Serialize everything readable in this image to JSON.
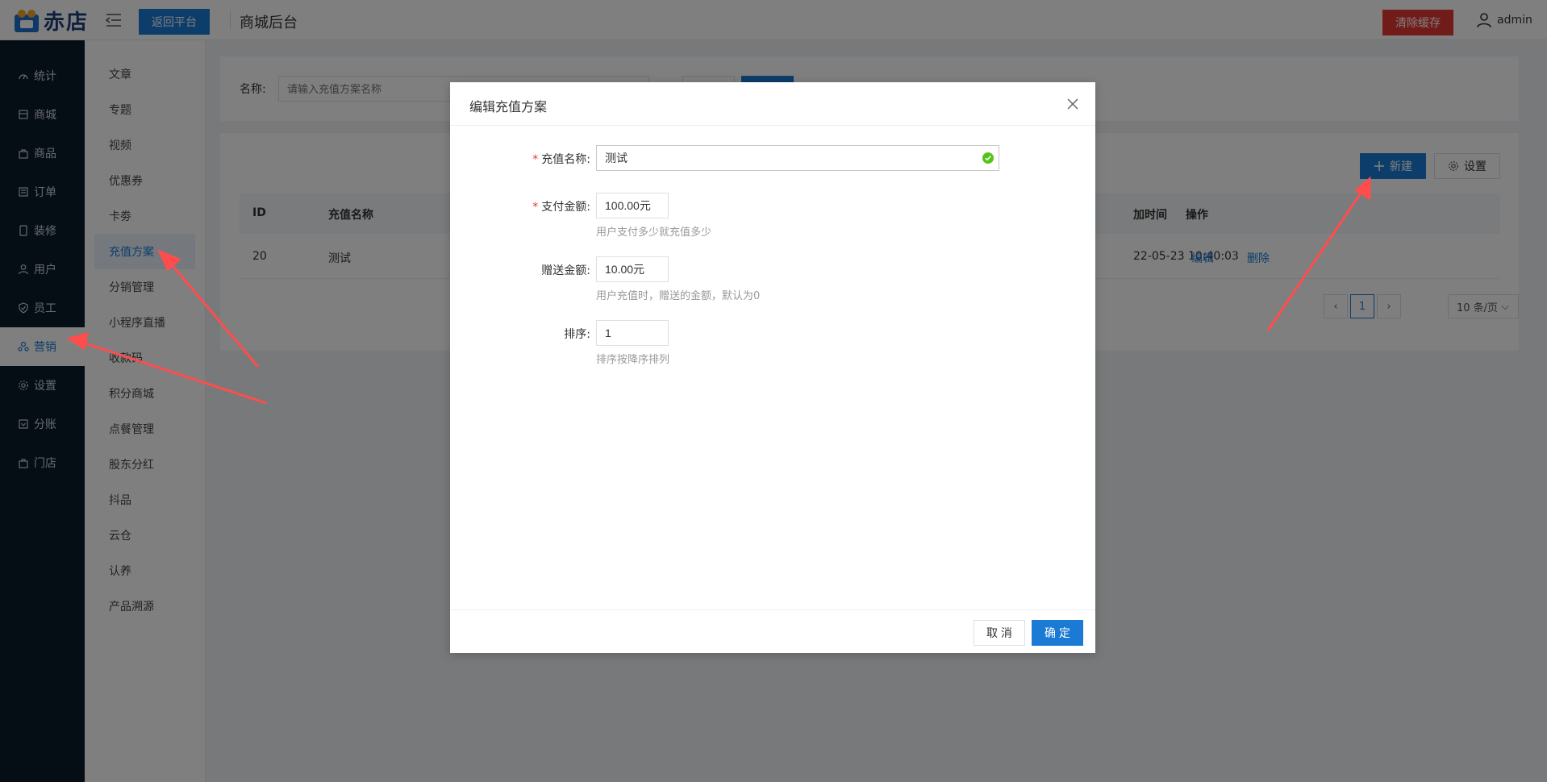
{
  "topbar": {
    "logo_text": "赤店",
    "back_label": "返回平台",
    "page_title": "商城后台",
    "clear_cache_label": "清除缓存",
    "username": "admin"
  },
  "sidebar": {
    "items": [
      {
        "label": "统计",
        "icon": "dashboard-icon"
      },
      {
        "label": "商城",
        "icon": "store-icon"
      },
      {
        "label": "商品",
        "icon": "bag-icon"
      },
      {
        "label": "订单",
        "icon": "order-icon"
      },
      {
        "label": "装修",
        "icon": "phone-icon"
      },
      {
        "label": "用户",
        "icon": "user-icon"
      },
      {
        "label": "员工",
        "icon": "shield-icon"
      },
      {
        "label": "营销",
        "icon": "marketing-icon",
        "active": true
      },
      {
        "label": "设置",
        "icon": "gear-icon"
      },
      {
        "label": "分账",
        "icon": "split-icon"
      },
      {
        "label": "门店",
        "icon": "shop-icon"
      }
    ]
  },
  "subnav": {
    "items": [
      {
        "label": "文章"
      },
      {
        "label": "专题"
      },
      {
        "label": "视频"
      },
      {
        "label": "优惠券"
      },
      {
        "label": "卡劵"
      },
      {
        "label": "充值方案",
        "active": true
      },
      {
        "label": "分销管理"
      },
      {
        "label": "小程序直播"
      },
      {
        "label": "收款码"
      },
      {
        "label": "积分商城"
      },
      {
        "label": "点餐管理"
      },
      {
        "label": "股东分红"
      },
      {
        "label": "抖品"
      },
      {
        "label": "云仓"
      },
      {
        "label": "认养"
      },
      {
        "label": "产品溯源"
      }
    ]
  },
  "search": {
    "label": "名称:",
    "placeholder": "请输入充值方案名称"
  },
  "table": {
    "new_label": "新建",
    "settings_label": "设置",
    "headers": [
      "ID",
      "充值名称",
      "加时间",
      "操作"
    ],
    "rows": [
      {
        "id": "20",
        "name": "测试",
        "time": "22-05-23 10:40:03",
        "edit": "编辑",
        "delete": "删除"
      }
    ],
    "pager": {
      "current": "1",
      "page_size": "10 条/页"
    }
  },
  "modal": {
    "title": "编辑充值方案",
    "fields": {
      "name": {
        "label": "充值名称:",
        "value": "测试"
      },
      "pay": {
        "label": "支付金额:",
        "value": "100.00元",
        "help": "用户支付多少就充值多少"
      },
      "gift": {
        "label": "赠送金额:",
        "value": "10.00元",
        "help": "用户充值时，赠送的金额，默认为0"
      },
      "sort": {
        "label": "排序:",
        "value": "1",
        "help": "排序按降序排列"
      }
    },
    "cancel_label": "取 消",
    "ok_label": "确 定"
  },
  "colors": {
    "primary": "#1a7ad4",
    "danger": "#e53935",
    "sidebar_bg": "#0b1a2b",
    "arrow": "#ff4d4d",
    "valid": "#52c41a"
  }
}
